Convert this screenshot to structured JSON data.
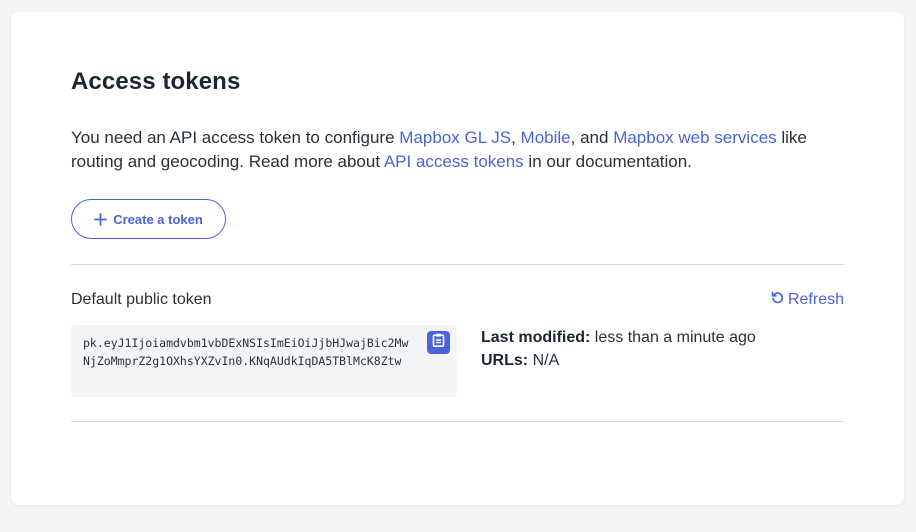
{
  "page": {
    "title": "Access tokens",
    "intro": {
      "text1": "You need an API access token to configure ",
      "link_gl_js": "Mapbox GL JS",
      "text2": ", ",
      "link_mobile": "Mobile",
      "text3": ", and ",
      "link_web_services": "Mapbox web services",
      "text4": " like routing and geocoding. Read more about ",
      "link_api_tokens": "API access tokens",
      "text5": " in our documentation."
    },
    "create_button": "Create a token"
  },
  "token": {
    "label": "Default public token",
    "refresh_label": "Refresh",
    "value": "pk.eyJ1Ijoiamdvbm1vbDExNSIsImEiOiJjbHJwajBic2MwNjZoMmprZ2g1OXhsYXZvIn0.KNqAUdkIqDA5TBlMcK8Ztw",
    "last_modified_key": "Last modified:",
    "last_modified_value": "less than a minute ago",
    "urls_key": "URLs:",
    "urls_value": "N/A"
  },
  "icons": {
    "plus": "plus-icon",
    "refresh": "refresh-icon",
    "copy": "clipboard-icon"
  },
  "colors": {
    "accent": "#4a64d8",
    "text": "#27313a",
    "background": "#f4f4f6",
    "token_box": "#f3f4f6"
  }
}
